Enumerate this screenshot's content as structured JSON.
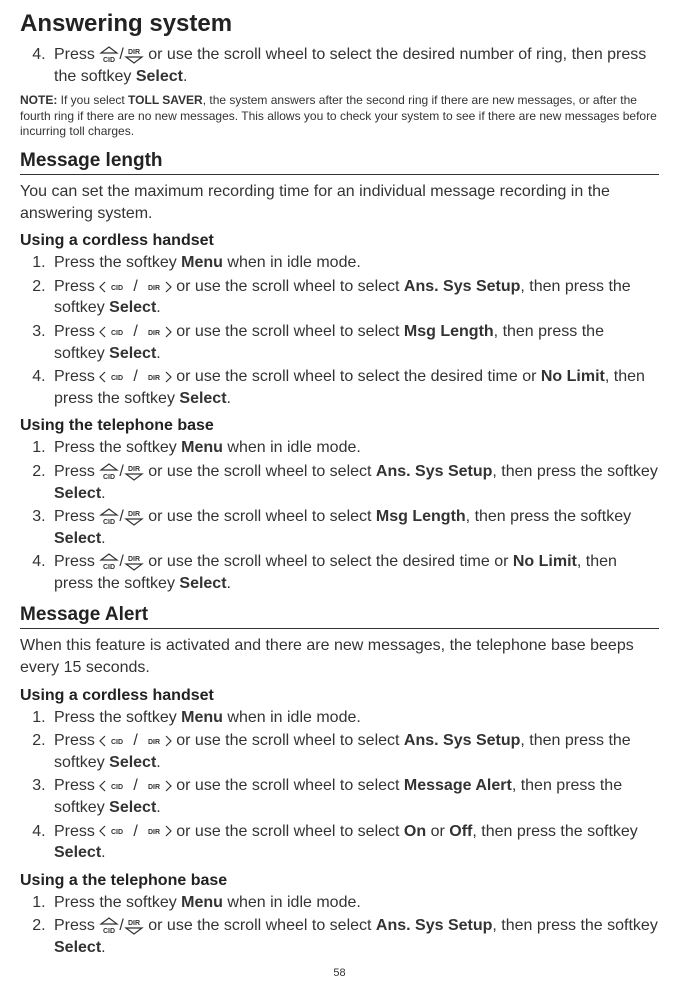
{
  "title": "Answering system",
  "intro_step": {
    "num": "4.",
    "pre": "Press ",
    "post": " or use the scroll wheel to select the desired number of ring, then press the softkey ",
    "softkey": "Select",
    "end": "."
  },
  "note": {
    "label": "NOTE:",
    "text_pre": " If you select ",
    "bold1": "TOLL SAVER",
    "text_post": ", the system answers after the second ring if there are new messages, or after the fourth ring if there are no new messages. This allows you to check your system to see if there are new messages before incurring toll charges."
  },
  "section1": {
    "heading": "Message length",
    "intro": "You can set the maximum recording time for an individual message recording in the answering system.",
    "sub1": {
      "heading": "Using a cordless handset",
      "steps": [
        {
          "pre": "Press the softkey ",
          "b1": "Menu",
          "post": " when in idle mode."
        },
        {
          "pre": "Press ",
          "icon": "h",
          "mid": " or use the scroll wheel to select ",
          "b1": "Ans. Sys Setup",
          "post": ", then press the softkey ",
          "b2": "Select",
          "end": "."
        },
        {
          "pre": "Press ",
          "icon": "h",
          "mid": " or use the scroll wheel to select ",
          "b1": "Msg Length",
          "post": ", then press the softkey ",
          "b2": "Select",
          "end": "."
        },
        {
          "pre": "Press ",
          "icon": "h",
          "mid": " or use the scroll wheel to select the desired time or ",
          "b1": "No Limit",
          "post": ", then press the softkey ",
          "b2": "Select",
          "end": "."
        }
      ]
    },
    "sub2": {
      "heading": "Using the telephone base",
      "steps": [
        {
          "pre": "Press the softkey ",
          "b1": "Menu",
          "post": " when in idle mode."
        },
        {
          "pre": "Press ",
          "icon": "v",
          "mid": " or use the scroll wheel to select ",
          "b1": "Ans. Sys Setup",
          "post": ", then press the softkey ",
          "b2": "Select",
          "end": "."
        },
        {
          "pre": "Press ",
          "icon": "v",
          "mid": " or use the scroll wheel to select ",
          "b1": "Msg Length",
          "post": ", then press the softkey ",
          "b2": "Select",
          "end": "."
        },
        {
          "pre": "Press ",
          "icon": "v",
          "mid": " or use the scroll wheel to select the desired time or ",
          "b1": "No Limit",
          "post": ", then press the softkey ",
          "b2": "Select",
          "end": "."
        }
      ]
    }
  },
  "section2": {
    "heading": "Message Alert",
    "intro": "When this feature is activated and there are new messages, the telephone base beeps every 15 seconds.",
    "sub1": {
      "heading": "Using a cordless handset",
      "steps": [
        {
          "pre": "Press the softkey ",
          "b1": "Menu",
          "post": " when in idle mode."
        },
        {
          "pre": "Press ",
          "icon": "h",
          "mid": " or use the scroll wheel to select ",
          "b1": "Ans. Sys Setup",
          "post": ", then press the softkey ",
          "b2": "Select",
          "end": "."
        },
        {
          "pre": "Press ",
          "icon": "h",
          "mid": " or use the scroll wheel to select ",
          "b1": "Message Alert",
          "post": ", then press the softkey ",
          "b2": "Select",
          "end": "."
        },
        {
          "pre": "Press ",
          "icon": "h",
          "mid": " or use the scroll wheel to select ",
          "b1": "On",
          "mid2": " or ",
          "b1b": "Off",
          "post": ", then press the softkey ",
          "b2": "Select",
          "end": "."
        }
      ]
    },
    "sub2": {
      "heading": "Using a the telephone base",
      "steps": [
        {
          "pre": "Press the softkey ",
          "b1": "Menu",
          "post": " when in idle mode."
        },
        {
          "pre": "Press ",
          "icon": "v",
          "mid": " or use the scroll wheel to select ",
          "b1": "Ans. Sys Setup",
          "post": ", then press the softkey ",
          "b2": "Select",
          "end": "."
        }
      ]
    }
  },
  "page_number": "58"
}
